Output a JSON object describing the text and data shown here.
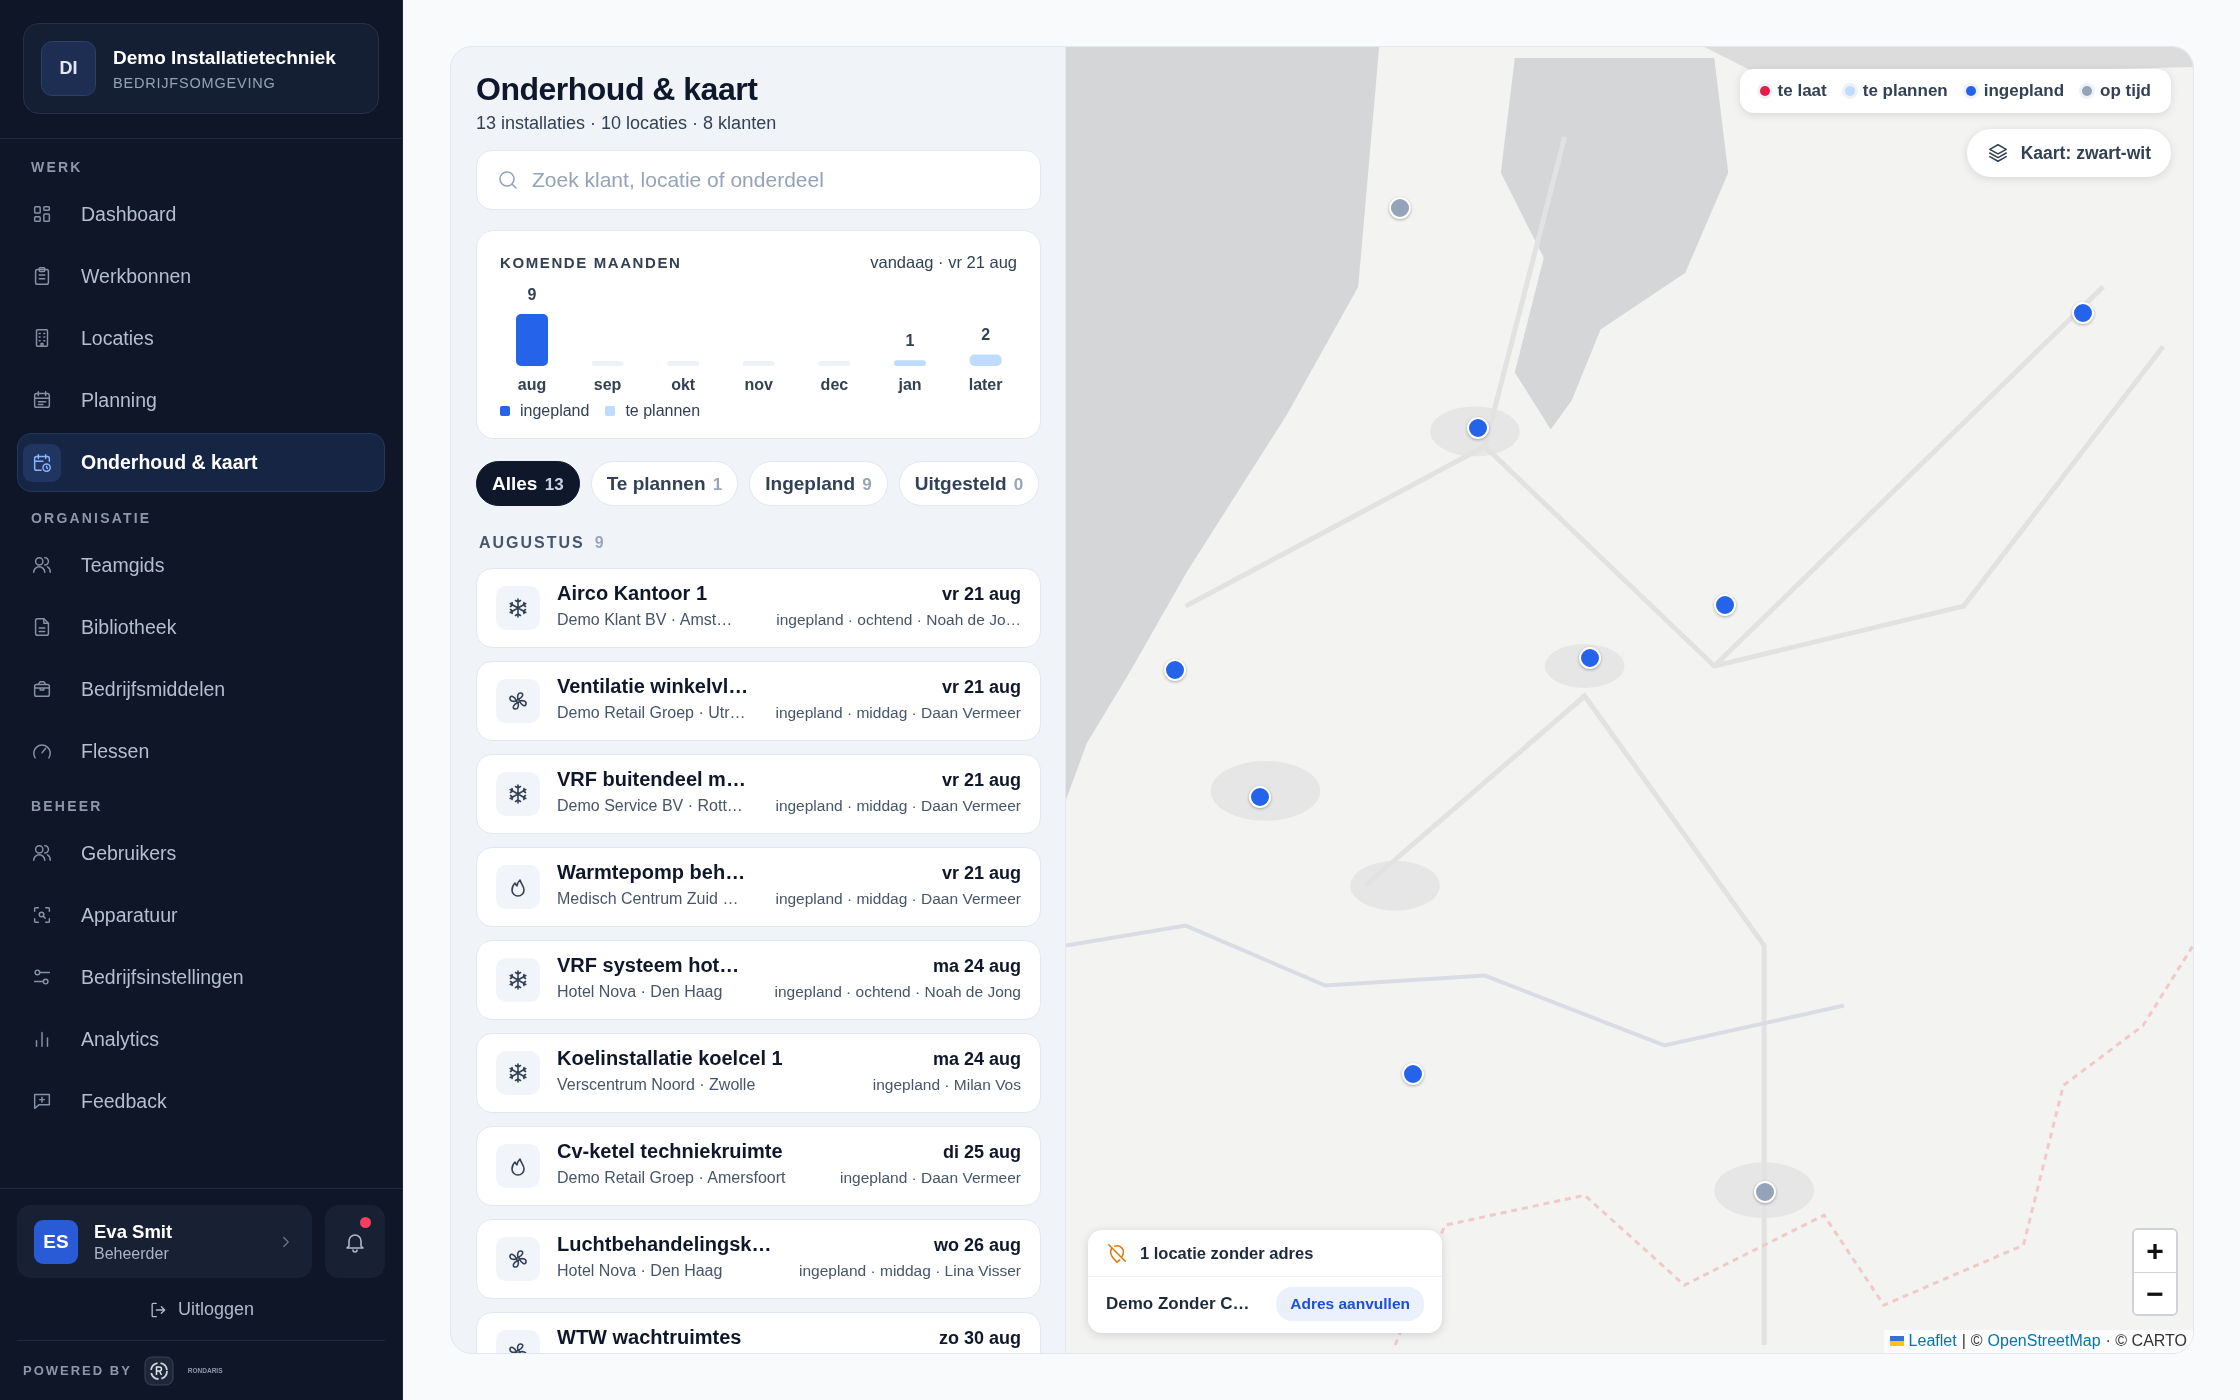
{
  "sidebar": {
    "brand": {
      "initials": "DI",
      "name": "Demo Installatietechniek",
      "subtitle": "BEDRIJFSOMGEVING"
    },
    "sections": [
      {
        "title": "WERK",
        "items": [
          {
            "label": "Dashboard",
            "selected": false
          },
          {
            "label": "Werkbonnen",
            "selected": false
          },
          {
            "label": "Locaties",
            "selected": false
          },
          {
            "label": "Planning",
            "selected": false
          },
          {
            "label": "Onderhoud & kaart",
            "selected": true
          }
        ]
      },
      {
        "title": "ORGANISATIE",
        "items": [
          {
            "label": "Teamgids",
            "selected": false
          },
          {
            "label": "Bibliotheek",
            "selected": false
          },
          {
            "label": "Bedrijfsmiddelen",
            "selected": false
          },
          {
            "label": "Flessen",
            "selected": false
          }
        ]
      },
      {
        "title": "BEHEER",
        "items": [
          {
            "label": "Gebruikers",
            "selected": false
          },
          {
            "label": "Apparatuur",
            "selected": false
          },
          {
            "label": "Bedrijfsinstellingen",
            "selected": false
          },
          {
            "label": "Analytics",
            "selected": false
          },
          {
            "label": "Feedback",
            "selected": false
          }
        ]
      }
    ],
    "user": {
      "initials": "ES",
      "name": "Eva Smit",
      "role": "Beheerder",
      "unread": true
    },
    "logout": "Uitloggen",
    "powered_by": "POWERED BY",
    "powered_brand": "RONDARIS"
  },
  "page": {
    "title": "Onderhoud & kaart",
    "subtitle": "13 installaties · 10 locaties · 8 klanten",
    "search": {
      "placeholder": "Zoek klant, locatie of onderdeel"
    },
    "forecast": {
      "title": "KOMENDE MAANDEN",
      "today": "vandaag · vr 21 aug",
      "chart_data": {
        "type": "bar",
        "categories": [
          "aug",
          "sep",
          "okt",
          "nov",
          "dec",
          "jan",
          "later"
        ],
        "stacked": true,
        "data_labels": true,
        "series": [
          {
            "name": "ingepland",
            "color": "#2563eb",
            "values": [
              9,
              null,
              null,
              null,
              null,
              null,
              null
            ]
          },
          {
            "name": "te plannen",
            "color": "#bfdbfe",
            "values": [
              null,
              null,
              null,
              null,
              null,
              1,
              2
            ]
          }
        ]
      }
    },
    "filters": [
      {
        "label": "Alles",
        "count": "13",
        "selected": true
      },
      {
        "label": "Te plannen",
        "count": "1",
        "selected": false
      },
      {
        "label": "Ingepland",
        "count": "9",
        "selected": false
      },
      {
        "label": "Uitgesteld",
        "count": "0",
        "selected": false
      }
    ],
    "group": {
      "title": "AUGUSTUS",
      "count": "9"
    },
    "items": [
      {
        "kind": "cooling",
        "title": "Airco Kantoor 1",
        "subtitle": "Demo Klant BV · Amst…",
        "date": "vr 21 aug",
        "meta": "ingepland · ochtend · Noah de Jo…"
      },
      {
        "kind": "ventilation",
        "title": "Ventilatie winkelvl…",
        "subtitle": "Demo Retail Groep · Utr…",
        "date": "vr 21 aug",
        "meta": "ingepland · middag · Daan Vermeer"
      },
      {
        "kind": "cooling",
        "title": "VRF buitendeel m…",
        "subtitle": "Demo Service BV · Rott…",
        "date": "vr 21 aug",
        "meta": "ingepland · middag · Daan Vermeer"
      },
      {
        "kind": "heating",
        "title": "Warmtepomp beh…",
        "subtitle": "Medisch Centrum Zuid …",
        "date": "vr 21 aug",
        "meta": "ingepland · middag · Daan Vermeer"
      },
      {
        "kind": "cooling",
        "title": "VRF systeem hot…",
        "subtitle": "Hotel Nova · Den Haag",
        "date": "ma 24 aug",
        "meta": "ingepland · ochtend · Noah de Jong"
      },
      {
        "kind": "cooling",
        "title": "Koelinstallatie koelcel 1",
        "subtitle": "Verscentrum Noord · Zwolle",
        "date": "ma 24 aug",
        "meta": "ingepland · Milan Vos"
      },
      {
        "kind": "heating",
        "title": "Cv-ketel techniekruimte",
        "subtitle": "Demo Retail Groep · Amersfoort",
        "date": "di 25 aug",
        "meta": "ingepland · Daan Vermeer"
      },
      {
        "kind": "ventilation",
        "title": "Luchtbehandelingsk…",
        "subtitle": "Hotel Nova · Den Haag",
        "date": "wo 26 aug",
        "meta": "ingepland · middag · Lina Visser"
      },
      {
        "kind": "ventilation",
        "title": "WTW wachtruimtes",
        "date": "zo 30 aug"
      }
    ]
  },
  "map": {
    "kind": "picture",
    "legend": [
      {
        "label": "te laat",
        "color": "#e11d48"
      },
      {
        "label": "te plannen",
        "color": "#bfdbfe"
      },
      {
        "label": "ingepland",
        "color": "#2563eb"
      },
      {
        "label": "op tijd",
        "color": "#94a3b8"
      }
    ],
    "markers": [
      {
        "color": "#94a3b8"
      },
      {
        "color": "#2563eb"
      },
      {
        "color": "#2563eb"
      },
      {
        "color": "#2563eb"
      },
      {
        "color": "#2563eb"
      },
      {
        "color": "#2563eb"
      },
      {
        "color": "#2563eb"
      },
      {
        "color": "#2563eb"
      },
      {
        "color": "#94a3b8"
      }
    ],
    "layer_button": "Kaart: zwart-wit",
    "missing": {
      "title": "1 locatie zonder adres",
      "name": "Demo Zonder C…",
      "action": "Adres aanvullen"
    },
    "zoom_in": "+",
    "zoom_out": "−",
    "attribution": [
      {
        "text": "Leaflet",
        "kind": "link"
      },
      {
        "text": "|",
        "kind": "text"
      },
      {
        "text": "©",
        "kind": "text"
      },
      {
        "text": "OpenStreetMap",
        "kind": "link"
      },
      {
        "text": "· © CARTO",
        "kind": "text"
      }
    ]
  }
}
